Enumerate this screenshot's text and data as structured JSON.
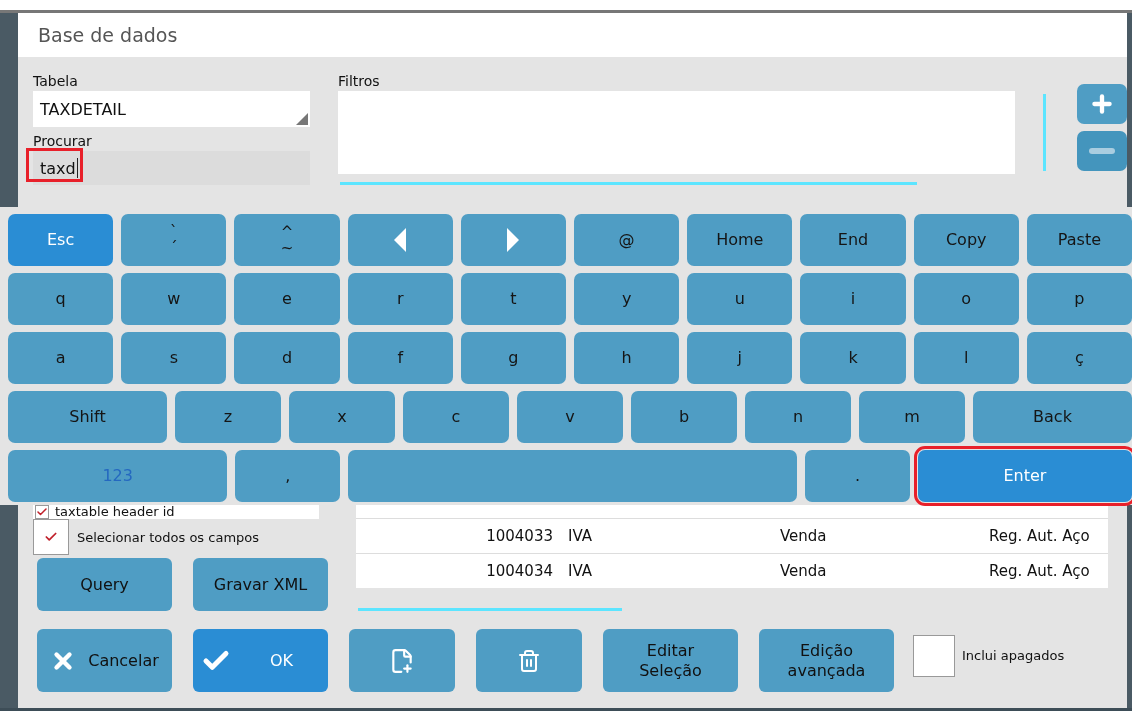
{
  "window": {
    "title": "Base de dados"
  },
  "table_field": {
    "label": "Tabela",
    "value": "TAXDETAIL"
  },
  "search_field": {
    "label": "Procurar",
    "value": "taxd",
    "annotated": true
  },
  "filters": {
    "label": "Filtros"
  },
  "keyboard": {
    "rows": [
      {
        "keys": [
          {
            "kind": "function",
            "label": "Esc",
            "active": true,
            "annotated": false
          },
          {
            "kind": "dual",
            "top": "`",
            "bottom": "´",
            "active": false,
            "annotated": false
          },
          {
            "kind": "dual",
            "top": "^",
            "bottom": "~",
            "active": false,
            "annotated": false
          },
          {
            "kind": "arrow_left",
            "active": false,
            "annotated": false
          },
          {
            "kind": "arrow_right",
            "active": false,
            "annotated": false
          },
          {
            "kind": "char",
            "label": "@",
            "active": false,
            "annotated": false
          },
          {
            "kind": "function",
            "label": "Home",
            "active": false,
            "annotated": false
          },
          {
            "kind": "function",
            "label": "End",
            "active": false,
            "annotated": false
          },
          {
            "kind": "function",
            "label": "Copy",
            "active": false,
            "annotated": false
          },
          {
            "kind": "function",
            "label": "Paste",
            "active": false,
            "annotated": false
          }
        ]
      },
      {
        "keys": [
          {
            "kind": "char",
            "label": "q",
            "active": false,
            "annotated": false
          },
          {
            "kind": "char",
            "label": "w",
            "active": false,
            "annotated": false
          },
          {
            "kind": "char",
            "label": "e",
            "active": false,
            "annotated": false
          },
          {
            "kind": "char",
            "label": "r",
            "active": false,
            "annotated": false
          },
          {
            "kind": "char",
            "label": "t",
            "active": false,
            "annotated": false
          },
          {
            "kind": "char",
            "label": "y",
            "active": false,
            "annotated": false
          },
          {
            "kind": "char",
            "label": "u",
            "active": false,
            "annotated": false
          },
          {
            "kind": "char",
            "label": "i",
            "active": false,
            "annotated": false
          },
          {
            "kind": "char",
            "label": "o",
            "active": false,
            "annotated": false
          },
          {
            "kind": "char",
            "label": "p",
            "active": false,
            "annotated": false
          }
        ]
      },
      {
        "keys": [
          {
            "kind": "char",
            "label": "a",
            "active": false,
            "annotated": false
          },
          {
            "kind": "char",
            "label": "s",
            "active": false,
            "annotated": false
          },
          {
            "kind": "char",
            "label": "d",
            "active": false,
            "annotated": false
          },
          {
            "kind": "char",
            "label": "f",
            "active": false,
            "annotated": false
          },
          {
            "kind": "char",
            "label": "g",
            "active": false,
            "annotated": false
          },
          {
            "kind": "char",
            "label": "h",
            "active": false,
            "annotated": false
          },
          {
            "kind": "char",
            "label": "j",
            "active": false,
            "annotated": false
          },
          {
            "kind": "char",
            "label": "k",
            "active": false,
            "annotated": false
          },
          {
            "kind": "char",
            "label": "l",
            "active": false,
            "annotated": false
          },
          {
            "kind": "char",
            "label": "ç",
            "active": false,
            "annotated": false
          }
        ]
      },
      {
        "keys": [
          {
            "kind": "shift",
            "label": "Shift",
            "active": false,
            "annotated": false
          },
          {
            "kind": "char",
            "label": "z",
            "active": false,
            "annotated": false
          },
          {
            "kind": "char",
            "label": "x",
            "active": false,
            "annotated": false
          },
          {
            "kind": "char",
            "label": "c",
            "active": false,
            "annotated": false
          },
          {
            "kind": "char",
            "label": "v",
            "active": false,
            "annotated": false
          },
          {
            "kind": "char",
            "label": "b",
            "active": false,
            "annotated": false
          },
          {
            "kind": "char",
            "label": "n",
            "active": false,
            "annotated": false
          },
          {
            "kind": "char",
            "label": "m",
            "active": false,
            "annotated": false
          },
          {
            "kind": "back",
            "label": "Back",
            "active": false,
            "annotated": false
          }
        ]
      },
      {
        "keys": [
          {
            "kind": "mode",
            "label": "123",
            "active": false,
            "annotated": false
          },
          {
            "kind": "char",
            "label": ",",
            "active": false,
            "annotated": false
          },
          {
            "kind": "space",
            "active": false,
            "annotated": false
          },
          {
            "kind": "char",
            "label": ".",
            "active": false,
            "annotated": false
          },
          {
            "kind": "enter",
            "label": "Enter",
            "active": true,
            "annotated": true
          }
        ]
      }
    ]
  },
  "field_list": {
    "items": [
      {
        "label": "taxtable header id",
        "checked": true
      }
    ],
    "select_all": {
      "label": "Selecionar todos os campos",
      "checked": true
    }
  },
  "query_buttons": [
    "Query",
    "Gravar XML"
  ],
  "results": {
    "rows": [
      {
        "cells": [
          "1004033",
          "IVA",
          "Venda",
          "Reg. Aut. Aço"
        ]
      },
      {
        "cells": [
          "1004034",
          "IVA",
          "Venda",
          "Reg. Aut. Aço"
        ]
      }
    ]
  },
  "bottom_buttons": [
    {
      "kind": "cancel",
      "label": "Cancelar",
      "active": false
    },
    {
      "kind": "ok",
      "label": "OK",
      "active": true
    },
    {
      "kind": "new_document",
      "active": false
    },
    {
      "kind": "delete",
      "active": false
    },
    {
      "kind": "text",
      "label": "Editar Seleção",
      "active": false
    },
    {
      "kind": "text",
      "label": "Edição avançada",
      "active": false
    }
  ],
  "include_deleted": {
    "label": "Inclui apagados",
    "checked": false
  }
}
